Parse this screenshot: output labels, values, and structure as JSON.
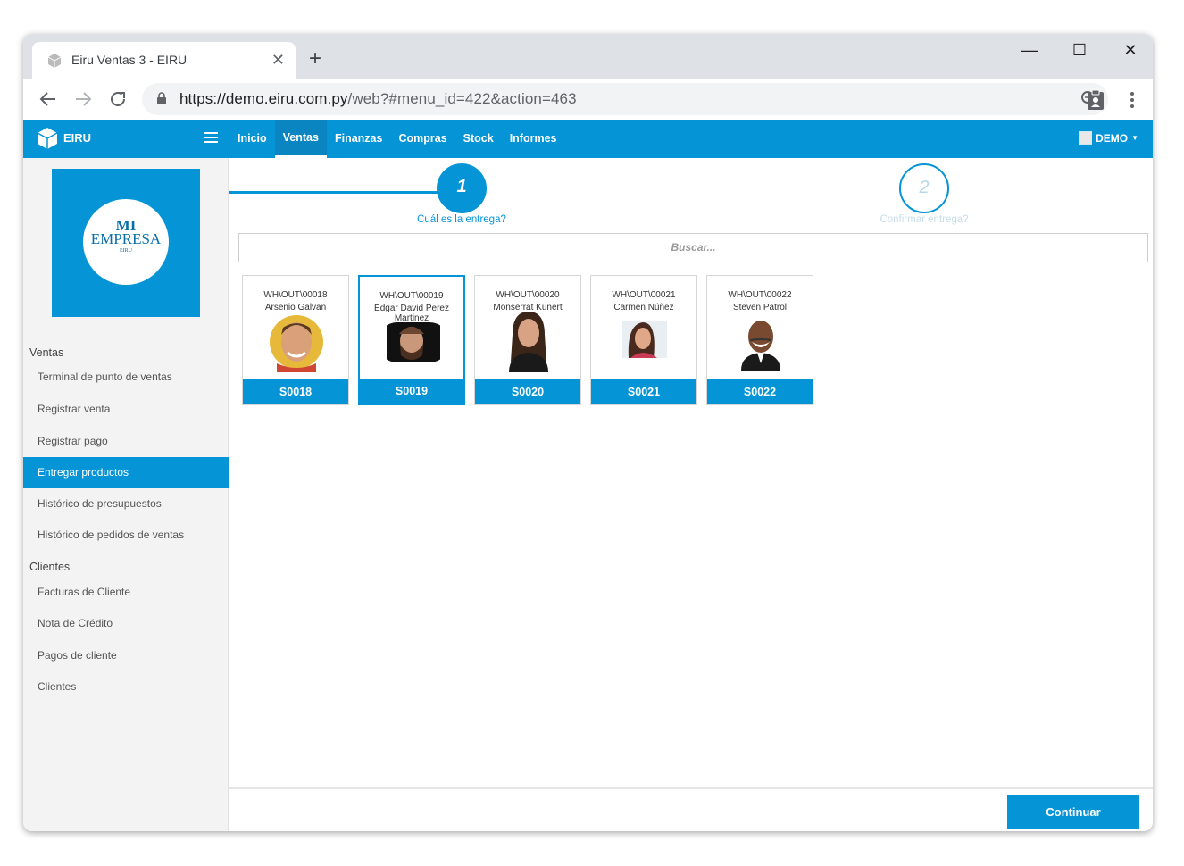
{
  "browser": {
    "tab_title": "Eiru Ventas 3 - EIRU",
    "close_glyph": "✕",
    "new_tab_glyph": "+",
    "url_host": "https://demo.eiru.com.py",
    "url_path": "/web?#menu_id=422&action=463",
    "window_controls": [
      "—",
      "☐",
      "✕"
    ]
  },
  "app": {
    "brand": "EIRU",
    "nav": [
      "Inicio",
      "Ventas",
      "Finanzas",
      "Compras",
      "Stock",
      "Informes"
    ],
    "active_nav": "Ventas",
    "user": "DEMO"
  },
  "company_logo": {
    "line1": "MI",
    "line2": "EMPRESA",
    "line3": "EIRU"
  },
  "sidebar": {
    "ventas_title": "Ventas",
    "ventas_items": [
      "Terminal de punto de ventas",
      "Registrar venta",
      "Registrar pago",
      "Entregar productos",
      "Histórico de presupuestos",
      "Histórico de pedidos de ventas"
    ],
    "clientes_title": "Clientes",
    "clientes_items": [
      "Facturas de Cliente",
      "Nota de Crédito",
      "Pagos de cliente",
      "Clientes"
    ]
  },
  "wizard": {
    "step1_num": "1",
    "step1_label": "Cuál es la entrega?",
    "step2_num": "2",
    "step2_label": "Confirmar entrega?"
  },
  "search": {
    "placeholder": "Buscar..."
  },
  "cards": [
    {
      "ref": "WH\\OUT\\00018",
      "partner": "Arsenio Galvan",
      "order": "S0018"
    },
    {
      "ref": "WH\\OUT\\00019",
      "partner": "Edgar David Perez Martinez",
      "order": "S0019"
    },
    {
      "ref": "WH\\OUT\\00020",
      "partner": "Monserrat Kunert",
      "order": "S0020"
    },
    {
      "ref": "WH\\OUT\\00021",
      "partner": "Carmen Núñez",
      "order": "S0021"
    },
    {
      "ref": "WH\\OUT\\00022",
      "partner": "Steven Patrol",
      "order": "S0022"
    }
  ],
  "continue_label": "Continuar",
  "colors": {
    "primary": "#0594d6",
    "sidebar_bg": "#f3f3f3"
  }
}
